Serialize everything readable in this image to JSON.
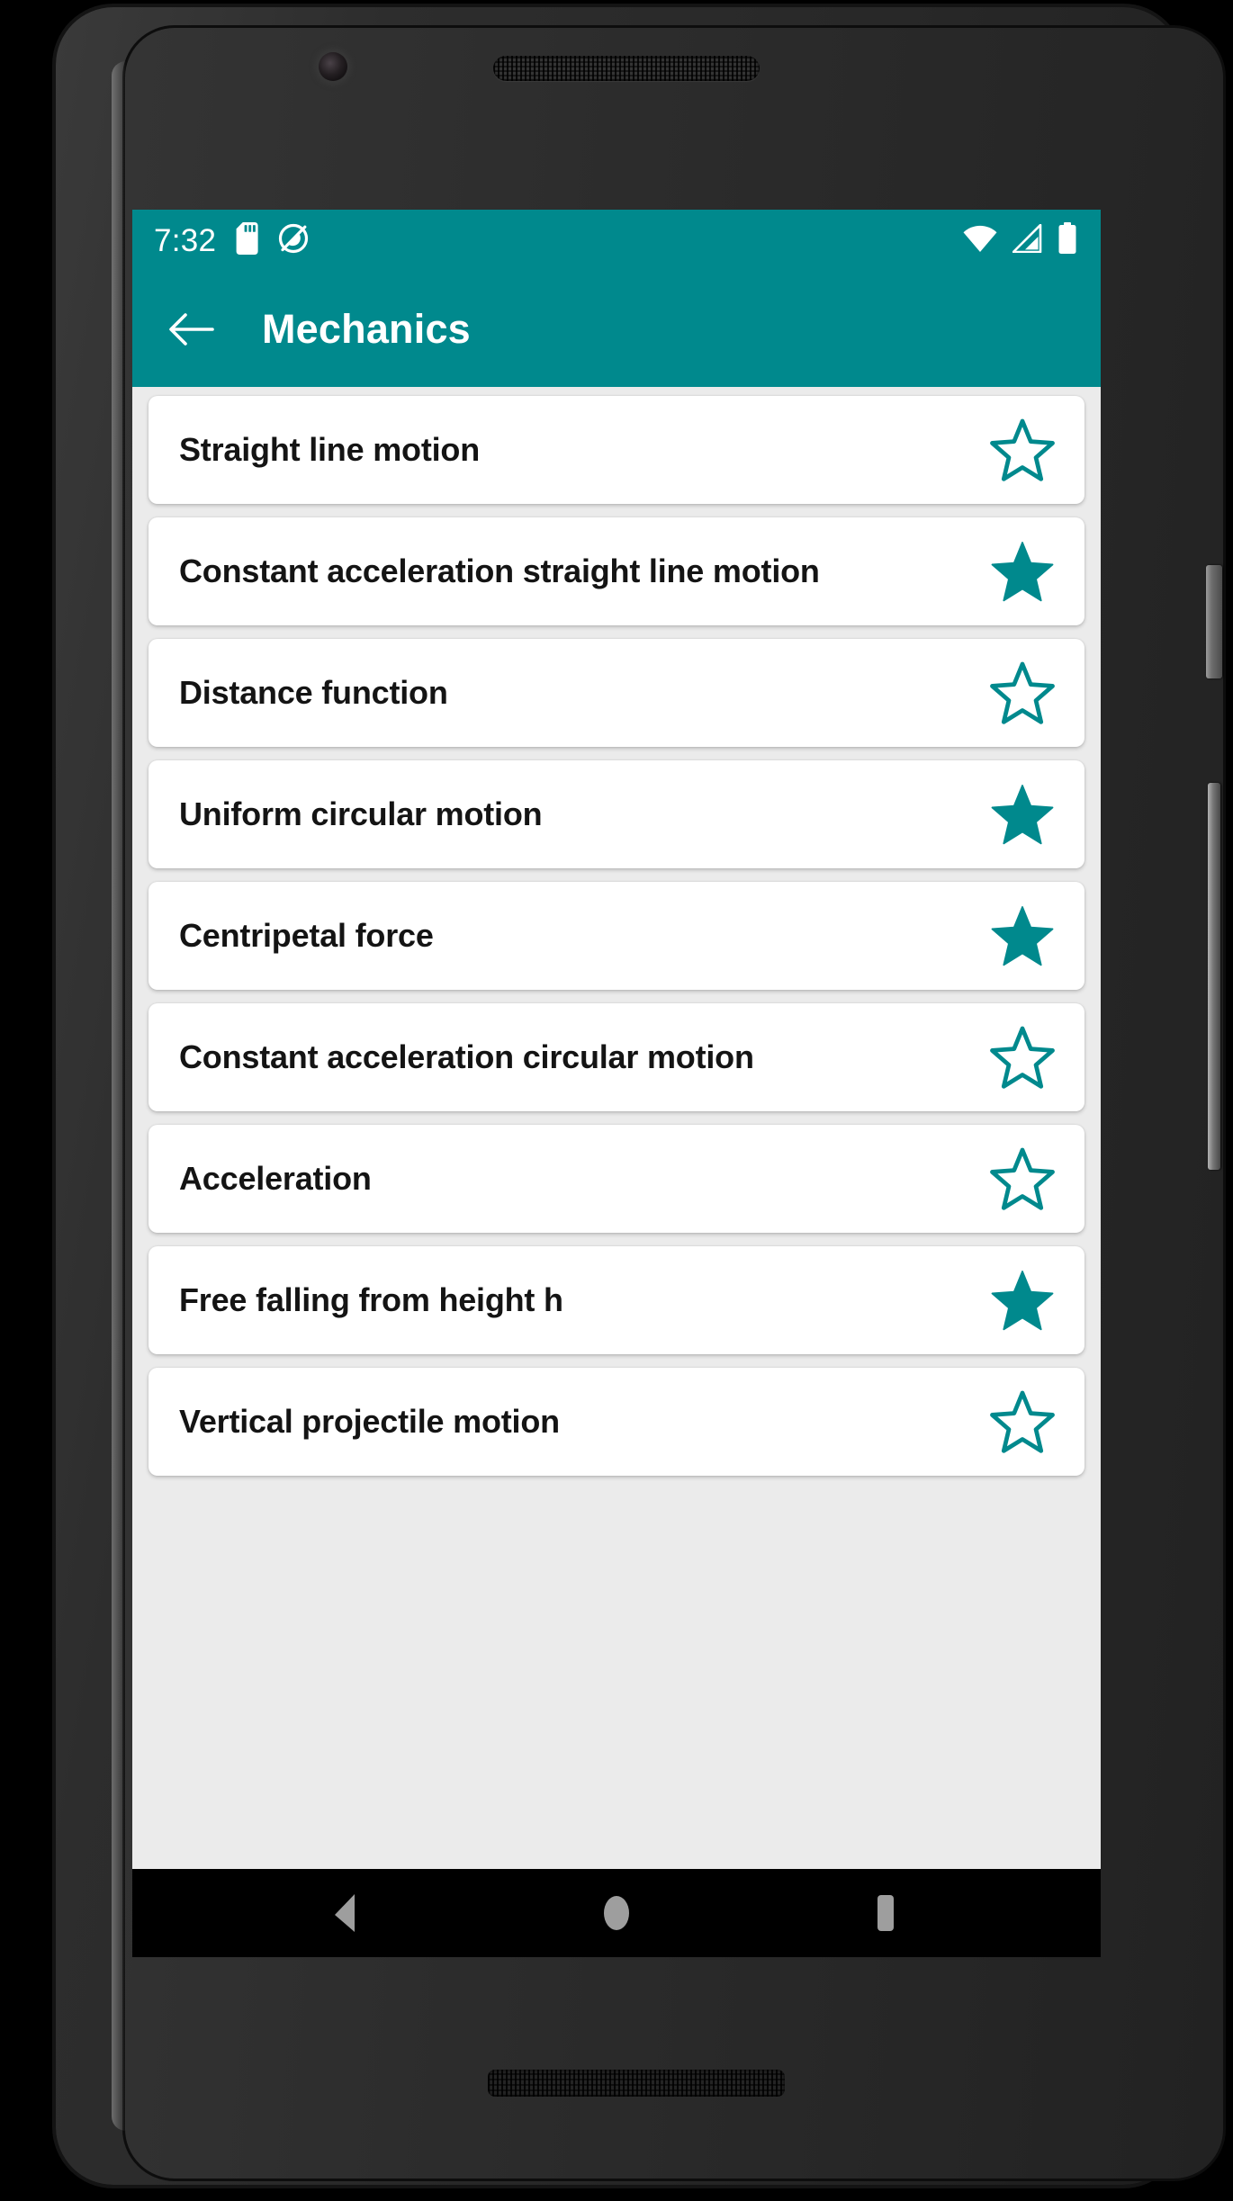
{
  "device": {
    "camera_icon": "front-camera-icon",
    "earpiece_icon": "earpiece-speaker-icon",
    "bottom_speaker_icon": "bottom-speaker-icon",
    "power_button": "power-button",
    "volume_button": "volume-rocker-button"
  },
  "status_bar": {
    "time": "7:32",
    "background_color": "#00898d",
    "left_icons": [
      "sd-card-icon",
      "do-not-disturb-icon"
    ],
    "right_icons": [
      "wifi-icon",
      "cellular-signal-icon",
      "battery-icon"
    ]
  },
  "app_bar": {
    "back_icon": "back-arrow-icon",
    "title": "Mechanics",
    "background_color": "#00898d",
    "title_color": "#ffffff"
  },
  "list": {
    "background_color": "#ebebeb",
    "card_color": "#ffffff",
    "star_color": "#00898d",
    "items": [
      {
        "label": "Straight line motion",
        "favorite": false
      },
      {
        "label": "Constant acceleration straight line motion",
        "favorite": true
      },
      {
        "label": "Distance function",
        "favorite": false
      },
      {
        "label": "Uniform circular motion",
        "favorite": true
      },
      {
        "label": "Centripetal force",
        "favorite": true
      },
      {
        "label": "Constant acceleration circular motion",
        "favorite": false
      },
      {
        "label": "Acceleration",
        "favorite": false
      },
      {
        "label": "Free falling from height h",
        "favorite": true
      },
      {
        "label": "Vertical projectile motion",
        "favorite": false
      }
    ]
  },
  "nav_bar": {
    "background_color": "#000000",
    "keys": [
      "back-nav-icon",
      "home-nav-icon",
      "recents-nav-icon"
    ]
  }
}
